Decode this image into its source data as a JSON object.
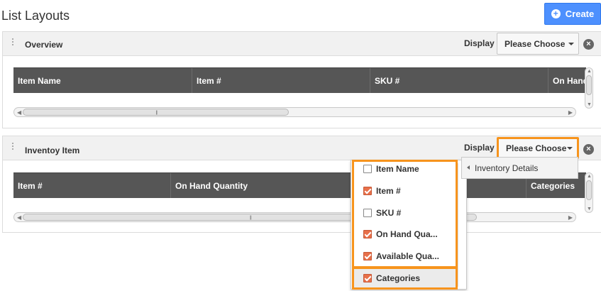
{
  "page": {
    "title": "List Layouts",
    "create_label": "Create"
  },
  "overview": {
    "title": "Overview",
    "display_label": "Display",
    "choose_label": "Please Choose",
    "columns": [
      "Item Name",
      "Item #",
      "SKU #",
      "On Hand"
    ]
  },
  "inventory": {
    "title": "Inventoy Item",
    "display_label": "Display",
    "choose_label": "Please Choose",
    "columns": [
      "Item #",
      "On Hand Quantity",
      "Categories"
    ]
  },
  "dropdown": {
    "items": [
      {
        "label": "Item Name",
        "checked": false
      },
      {
        "label": "Item #",
        "checked": true
      },
      {
        "label": "SKU #",
        "checked": false
      },
      {
        "label": "On Hand Qua...",
        "checked": true
      },
      {
        "label": "Available Qua...",
        "checked": true
      },
      {
        "label": "Categories",
        "checked": true
      }
    ]
  },
  "submenu": {
    "label": "Inventory Details"
  },
  "colors": {
    "accent": "#4d90fe",
    "highlight": "#f7941d",
    "checkbox_on": "#e8704a",
    "grid_header": "#565656"
  }
}
